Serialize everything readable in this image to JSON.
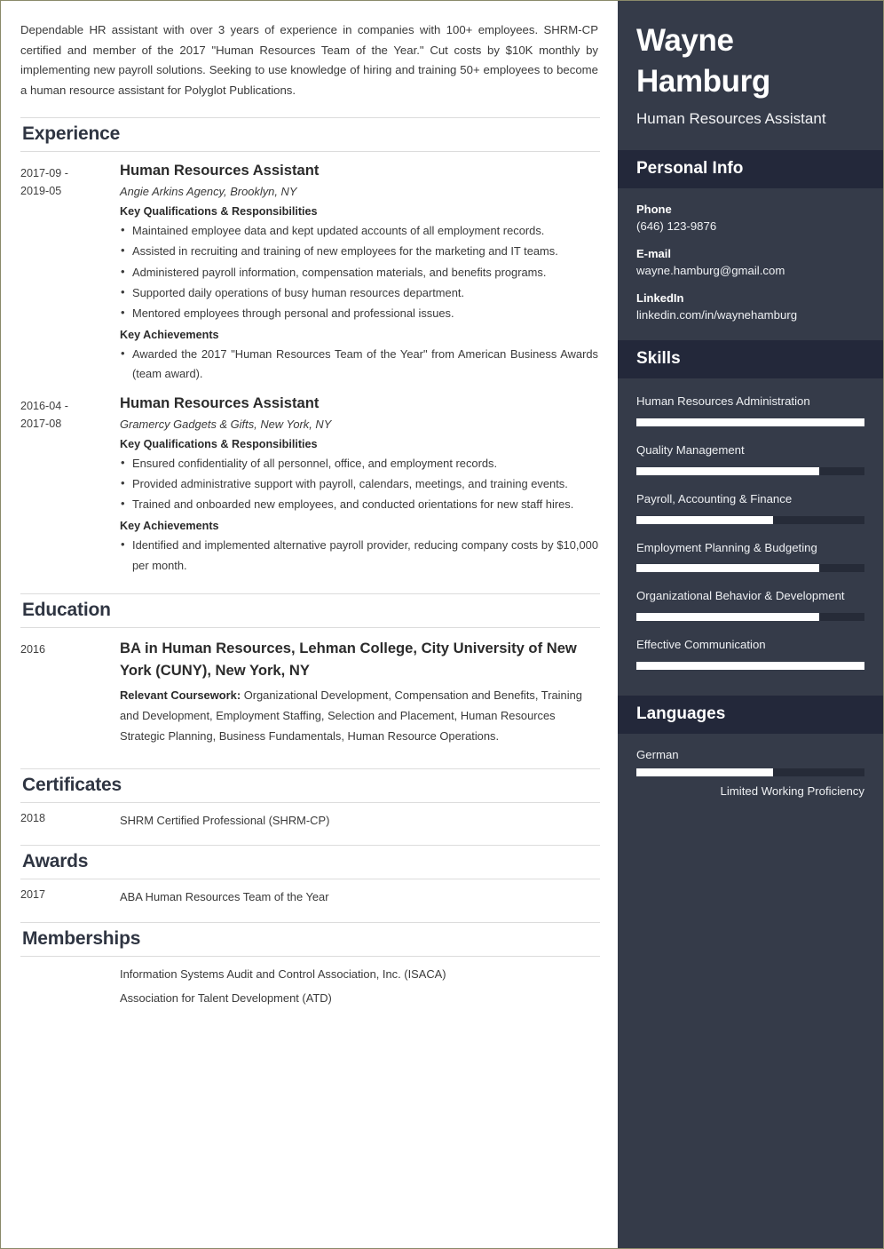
{
  "theme": {
    "page_border": "#8a8a6a",
    "sidebar_bg": "#353b49",
    "sidebar_bar_bg": "#23283a",
    "bar_track": "#262b38",
    "bar_fill": "#ffffff",
    "text_dark": "#2b2b2b",
    "rule": "#dcdcdc"
  },
  "main": {
    "summary": "Dependable HR assistant with over 3 years of experience in companies with 100+ employees. SHRM-CP certified and member of the 2017 \"Human Resources Team of the Year.\" Cut costs by $10K monthly by implementing new payroll solutions. Seeking to use knowledge of hiring and training 50+ employees to become a human resource assistant for Polyglot Publications.",
    "sections": {
      "experience": "Experience",
      "education": "Education",
      "certificates": "Certificates",
      "awards": "Awards",
      "memberships": "Memberships"
    },
    "labels": {
      "qualifications": "Key Qualifications & Responsibilities",
      "achievements": "Key Achievements",
      "coursework": "Relevant Coursework:"
    },
    "experience_items": [
      {
        "date_start": "2017-09 -",
        "date_end": "2019-05",
        "title": "Human Resources Assistant",
        "company": "Angie Arkins Agency, Brooklyn, NY",
        "responsibilities": [
          "Maintained employee data and kept updated accounts of all employment records.",
          "Assisted in recruiting and training of new employees for the marketing and IT teams.",
          "Administered payroll information, compensation materials, and benefits programs.",
          "Supported daily operations of busy human resources department.",
          "Mentored employees through personal and professional issues."
        ],
        "achievements": [
          "Awarded the 2017 \"Human Resources Team of the Year\" from American Business Awards (team award)."
        ]
      },
      {
        "date_start": "2016-04 -",
        "date_end": "2017-08",
        "title": "Human Resources Assistant",
        "company": "Gramercy Gadgets & Gifts, New York, NY",
        "responsibilities": [
          "Ensured confidentiality of all personnel, office, and employment records.",
          "Provided administrative support with payroll, calendars, meetings, and training events.",
          "Trained and onboarded new employees, and conducted orientations for new staff hires."
        ],
        "achievements": [
          "Identified and implemented alternative payroll provider, reducing company costs by $10,000 per month."
        ]
      }
    ],
    "education_items": [
      {
        "date": "2016",
        "title": "BA in Human Resources, Lehman College, City University of New York (CUNY), New York, NY",
        "coursework": "Organizational Development, Compensation and Benefits, Training and Development, Employment Staffing, Selection and Placement, Human Resources Strategic Planning, Business Fundamentals, Human Resource Operations."
      }
    ],
    "certificate_items": [
      {
        "date": "2018",
        "text": "SHRM Certified Professional (SHRM-CP)"
      }
    ],
    "award_items": [
      {
        "date": "2017",
        "text": "ABA Human Resources Team of the Year"
      }
    ],
    "membership_items": [
      {
        "date": "",
        "text": "Information Systems Audit and Control Association, Inc. (ISACA)"
      },
      {
        "date": "",
        "text": "Association for Talent Development (ATD)"
      }
    ]
  },
  "sidebar": {
    "name": "Wayne Hamburg",
    "role": "Human Resources Assistant",
    "personal_info_heading": "Personal Info",
    "personal_info": [
      {
        "label": "Phone",
        "value": "(646) 123-9876"
      },
      {
        "label": "E-mail",
        "value": "wayne.hamburg@gmail.com"
      },
      {
        "label": "LinkedIn",
        "value": "linkedin.com/in/waynehamburg"
      }
    ],
    "skills_heading": "Skills",
    "skills": [
      {
        "name": "Human Resources Administration",
        "level": 100
      },
      {
        "name": "Quality Management",
        "level": 80
      },
      {
        "name": "Payroll, Accounting & Finance",
        "level": 60
      },
      {
        "name": "Employment Planning & Budgeting",
        "level": 80
      },
      {
        "name": "Organizational Behavior & Development",
        "level": 80
      },
      {
        "name": "Effective Communication",
        "level": 100
      }
    ],
    "languages_heading": "Languages",
    "languages": [
      {
        "name": "German",
        "level": 60,
        "proficiency": "Limited Working Proficiency"
      }
    ]
  }
}
